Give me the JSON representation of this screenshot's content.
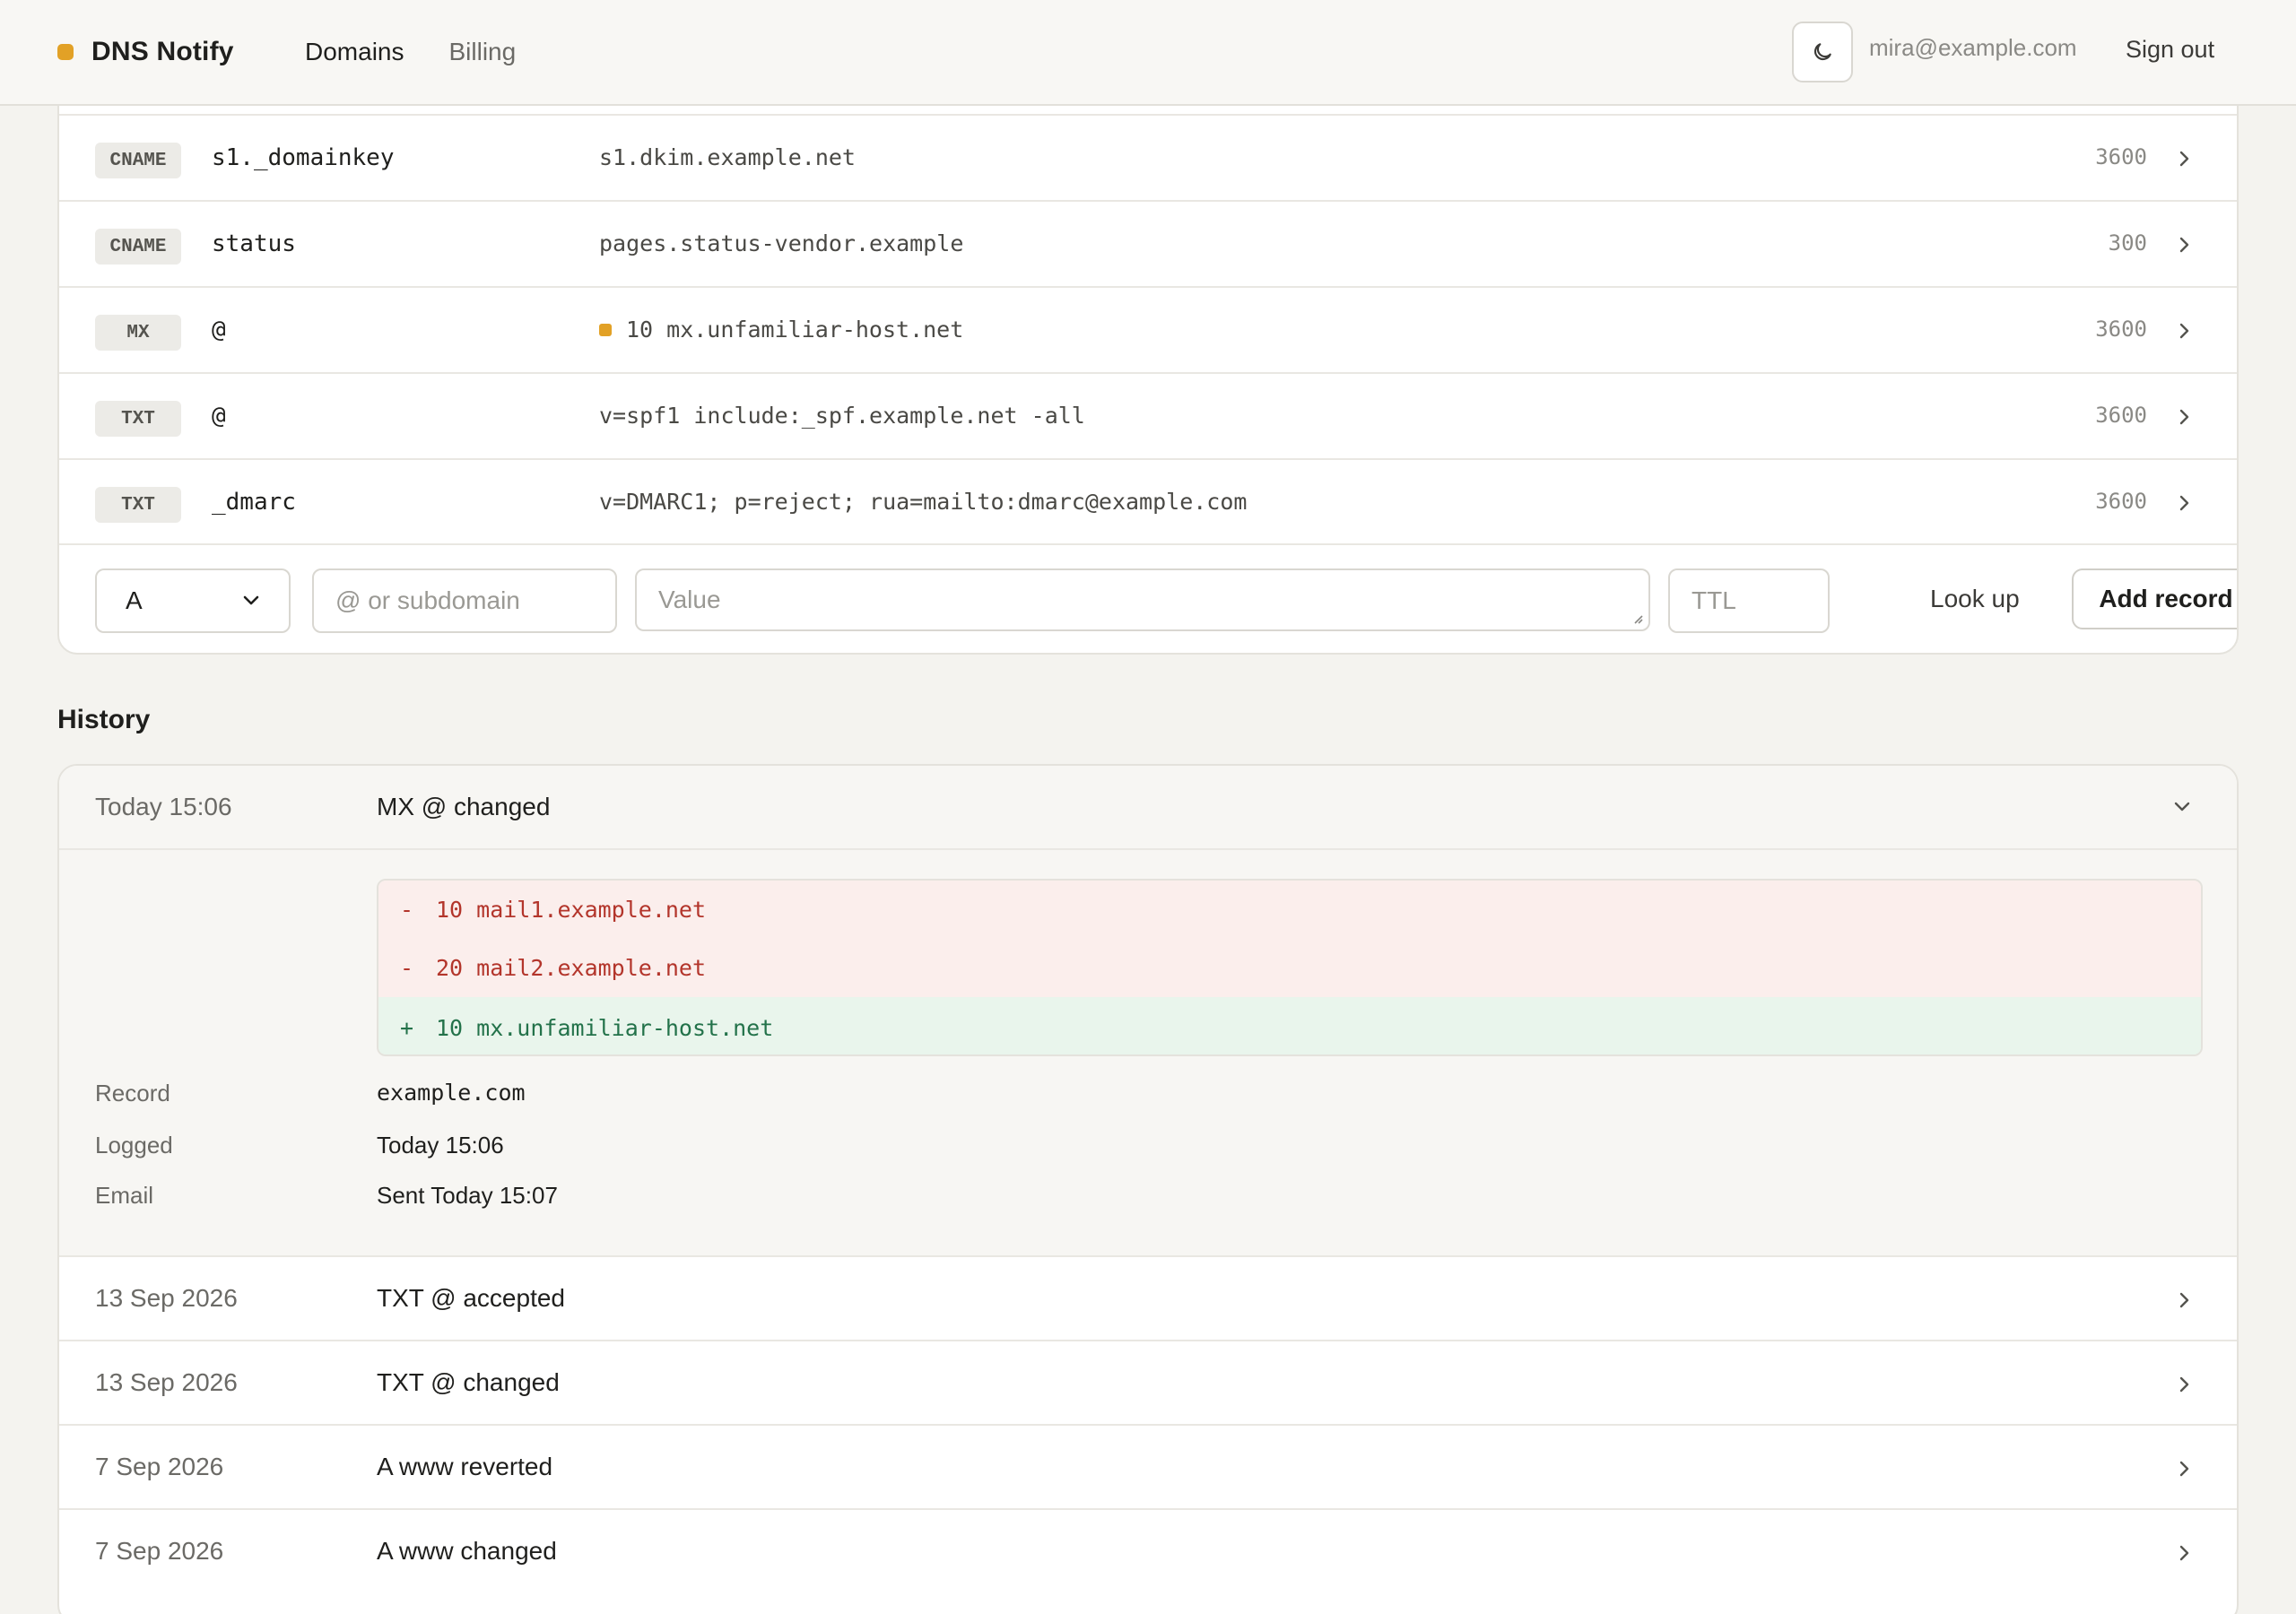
{
  "app": {
    "name": "DNS Notify",
    "accent": "#e2a126"
  },
  "nav": {
    "items": [
      {
        "label": "Domains",
        "active": true
      },
      {
        "label": "Billing",
        "active": false
      }
    ]
  },
  "user": {
    "email": "mira@example.com",
    "sign_out": "Sign out",
    "theme_toggle_icon": "moon-icon"
  },
  "records": [
    {
      "type": "CNAME",
      "name": "s1._domainkey",
      "value": "s1.dkim.example.net",
      "ttl": "3600",
      "flagged": false
    },
    {
      "type": "CNAME",
      "name": "status",
      "value": "pages.status-vendor.example",
      "ttl": "300",
      "flagged": false
    },
    {
      "type": "MX",
      "name": "@",
      "value": "10 mx.unfamiliar-host.net",
      "ttl": "3600",
      "flagged": true
    },
    {
      "type": "TXT",
      "name": "@",
      "value": "v=spf1 include:_spf.example.net -all",
      "ttl": "3600",
      "flagged": false
    },
    {
      "type": "TXT",
      "name": "_dmarc",
      "value": "v=DMARC1; p=reject; rua=mailto:dmarc@example.com",
      "ttl": "3600",
      "flagged": false
    }
  ],
  "add_record": {
    "type_value": "A",
    "name_placeholder": "@ or subdomain",
    "value_placeholder": "Value",
    "ttl_placeholder": "TTL",
    "lookup_label": "Look up",
    "add_label": "Add record"
  },
  "history": {
    "title": "History",
    "expanded": {
      "date": "Today 15:06",
      "summary": "MX @ changed",
      "diff": [
        {
          "sign": "-",
          "text": "10 mail1.example.net",
          "kind": "removed"
        },
        {
          "sign": "-",
          "text": "20 mail2.example.net",
          "kind": "removed"
        },
        {
          "sign": "+",
          "text": "10 mx.unfamiliar-host.net",
          "kind": "added"
        }
      ],
      "meta": [
        {
          "label": "Record",
          "value": "example.com"
        },
        {
          "label": "Logged",
          "value": "Today 15:06"
        },
        {
          "label": "Email",
          "value": "Sent Today 15:07"
        }
      ]
    },
    "items": [
      {
        "date": "13 Sep 2026",
        "summary": "TXT @ accepted"
      },
      {
        "date": "13 Sep 2026",
        "summary": "TXT @ changed"
      },
      {
        "date": "7 Sep 2026",
        "summary": "A www reverted"
      },
      {
        "date": "7 Sep 2026",
        "summary": "A www changed"
      }
    ]
  }
}
